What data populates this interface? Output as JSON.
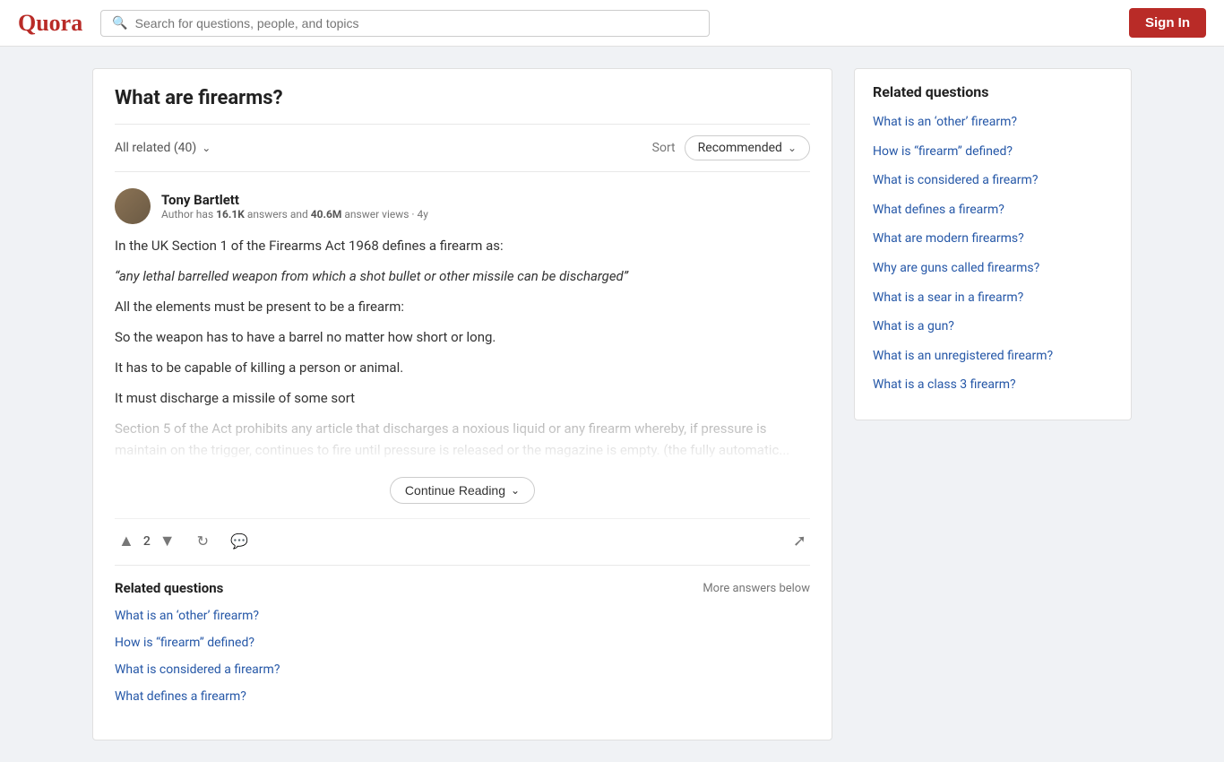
{
  "header": {
    "logo": "Quora",
    "search_placeholder": "Search for questions, people, and topics",
    "sign_in_label": "Sign In"
  },
  "question": {
    "title": "What are firearms?"
  },
  "filter_bar": {
    "all_related_label": "All related (40)",
    "sort_label": "Sort",
    "sort_value": "Recommended"
  },
  "answer": {
    "author_name": "Tony Bartlett",
    "author_meta_prefix": "Author has",
    "author_answers": "16.1K",
    "author_answers_suffix": "answers and",
    "author_views": "40.6M",
    "author_views_suffix": "answer views · 4y",
    "paragraphs": [
      "In the UK Section 1 of the Firearms Act 1968 defines a firearm as:",
      "“any lethal barrelled weapon from which a shot bullet or other missile can be discharged”",
      "All the elements must be present to be a firearm:",
      "So the weapon has to have a barrel no matter how short or long.",
      "It has to be capable of killing a person or animal.",
      "It must discharge a missile of some sort",
      "Section 5 of the Act prohibits any article that discharges a noxious liquid or any firearm whereby, if pressure is maintain on the trigger, continues to fire until pressure is released or the magazine is empty. (the fully automatic..."
    ],
    "continue_reading_label": "Continue Reading",
    "upvote_count": "2",
    "action_buttons": {
      "upvote": "▲",
      "downvote": "▼",
      "share_rotate": "↺",
      "comment": "💬",
      "share": "↗"
    }
  },
  "related_inline": {
    "title": "Related questions",
    "more_answers_label": "More answers below",
    "items": [
      "What is an ‘other’ firearm?",
      "How is “firearm” defined?",
      "What is considered a firearm?",
      "What defines a firearm?"
    ]
  },
  "sidebar": {
    "title": "Related questions",
    "items": [
      "What is an ‘other’ firearm?",
      "How is “firearm” defined?",
      "What is considered a firearm?",
      "What defines a firearm?",
      "What are modern firearms?",
      "Why are guns called firearms?",
      "What is a sear in a firearm?",
      "What is a gun?",
      "What is an unregistered firearm?",
      "What is a class 3 firearm?"
    ]
  }
}
